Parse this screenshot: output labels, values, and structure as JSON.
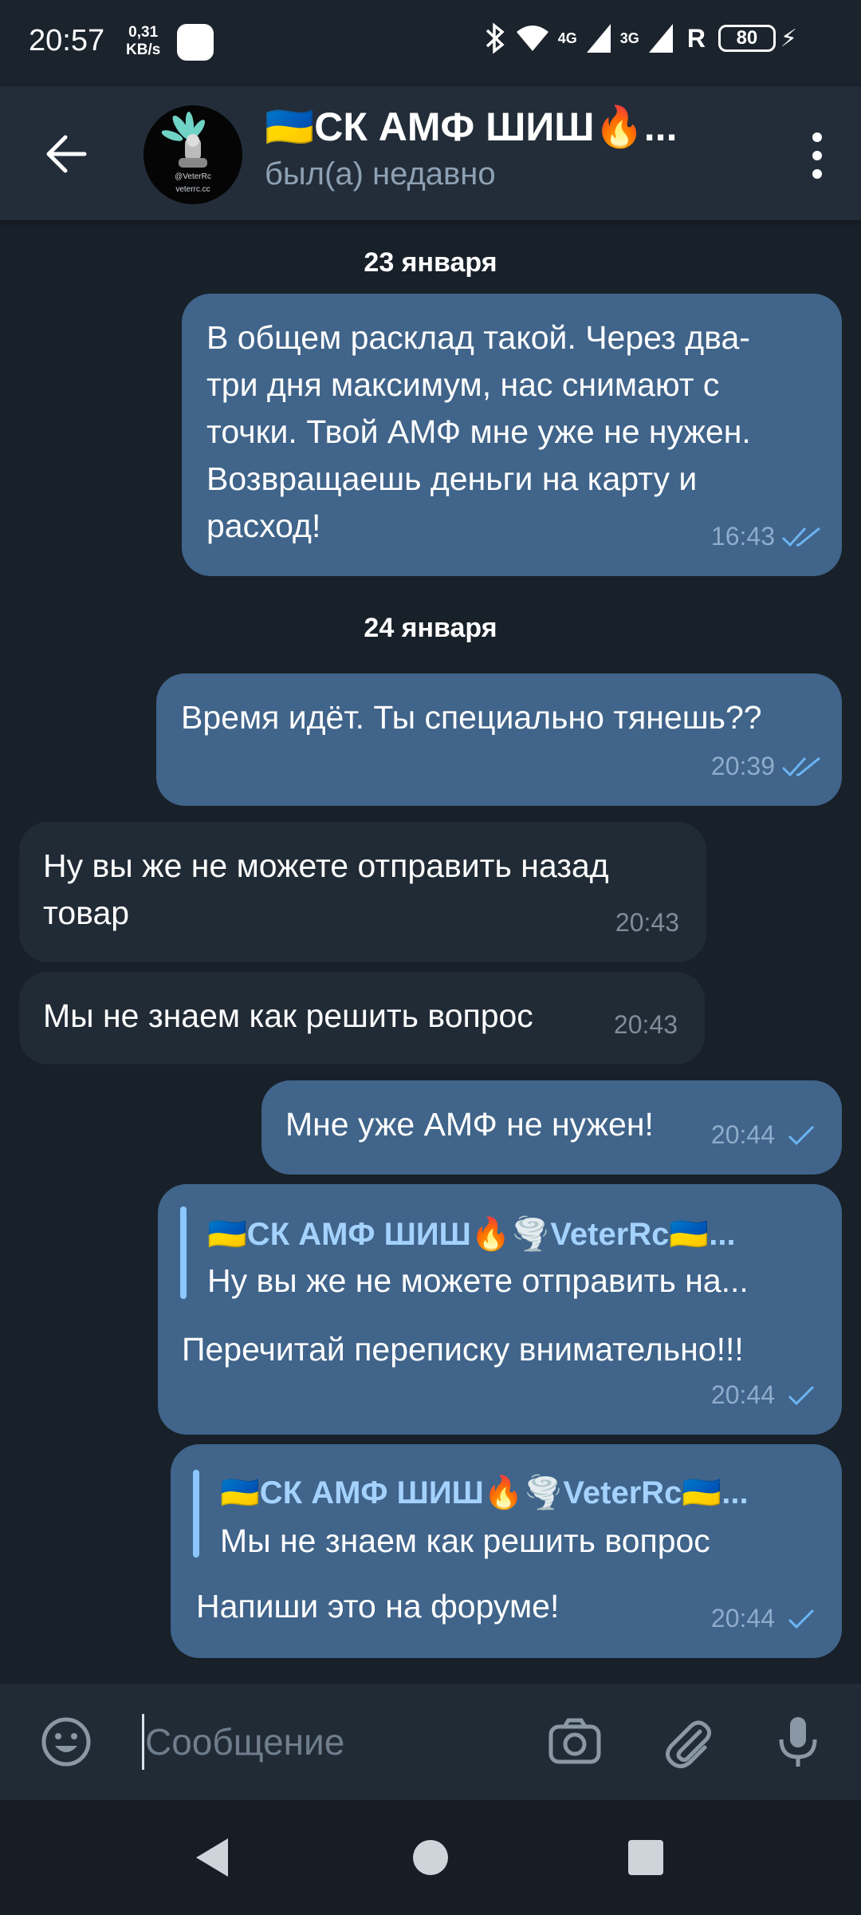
{
  "status_bar": {
    "time": "20:57",
    "speed_value": "0,31",
    "speed_unit": "KB/s",
    "net_4g": "4G",
    "net_3g": "3G",
    "roaming": "R",
    "battery": "80"
  },
  "header": {
    "title": "🇺🇦СК АМФ ШИШ🔥...",
    "status": "был(а) недавно",
    "avatar_caption_1": "@VeterRc",
    "avatar_caption_2": "veterrc.cc"
  },
  "dates": {
    "first": "23 января",
    "second": "24 января"
  },
  "messages": [
    {
      "lines": [
        "В общем расклад такой. Через два-",
        "три дня максимум, нас снимают с",
        "точки. Твой АМФ мне уже не нужен.",
        "Возвращаешь деньги на карту и",
        "расход!"
      ],
      "time": "16:43"
    },
    {
      "lines": [
        "Время идёт. Ты специально тянешь??"
      ],
      "time": "20:39"
    },
    {
      "lines": [
        "Ну вы же не можете отправить назад",
        "товар"
      ],
      "time": "20:43"
    },
    {
      "lines": [
        "Мы не знаем как решить вопрос"
      ],
      "time": "20:43"
    },
    {
      "lines": [
        "Мне уже АМФ не нужен!"
      ],
      "time": "20:44"
    },
    {
      "quote_name": "🇺🇦СК АМФ ШИШ🔥🌪️VeterRc🇺🇦...",
      "quote_text": "Ну вы же не можете отправить на...",
      "lines": [
        "Перечитай переписку внимательно!!!"
      ],
      "time": "20:44"
    },
    {
      "quote_name": "🇺🇦СК АМФ ШИШ🔥🌪️VeterRc🇺🇦...",
      "quote_text": "Мы не знаем как решить вопрос",
      "lines": [
        "Напиши это на форуме!"
      ],
      "time": "20:44"
    }
  ],
  "input": {
    "placeholder": "Сообщение"
  },
  "colors": {
    "background": "#182029",
    "outgoing_bubble": "#40648a",
    "incoming_bubble": "#212b36",
    "header": "#222d39",
    "accent": "#8cc8ff"
  }
}
